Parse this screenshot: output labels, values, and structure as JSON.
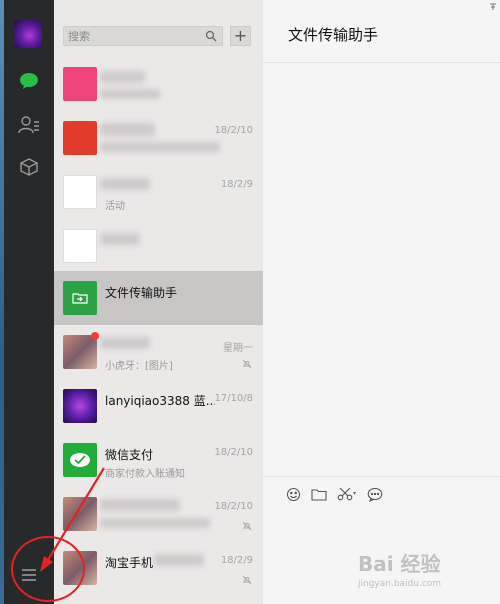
{
  "sidebar": {
    "items": [
      {
        "name": "avatar"
      },
      {
        "name": "chats-icon"
      },
      {
        "name": "contacts-icon"
      },
      {
        "name": "favorites-icon"
      },
      {
        "name": "menu-icon"
      }
    ]
  },
  "search": {
    "placeholder": "搜索"
  },
  "add_button": "+",
  "chats": [
    {
      "name": "",
      "preview": "",
      "time": "",
      "avatar_color": "#f0457a"
    },
    {
      "name": "",
      "preview": "",
      "time": "18/2/10",
      "avatar_color": "#e23b2c"
    },
    {
      "name": "",
      "preview": "活动",
      "time": "18/2/9",
      "avatar_color": "#ffffff"
    },
    {
      "name": "",
      "preview": "",
      "time": "",
      "avatar_color": "#ffffff"
    },
    {
      "name": "文件传输助手",
      "preview": "",
      "time": "",
      "avatar_color": "#2ba245"
    },
    {
      "name": "",
      "preview": "小虎牙：[图片]",
      "time": "星期一",
      "avatar_color": "#b97a6a"
    },
    {
      "name": "lanyiqiao3388 蓝...",
      "preview": "",
      "time": "17/10/8",
      "avatar_color": "#6a1fb0"
    },
    {
      "name": "微信支付",
      "preview": "商家付款入账通知",
      "time": "18/2/10",
      "avatar_color": "#22ac38"
    },
    {
      "name": "",
      "preview": "",
      "time": "18/2/10",
      "avatar_color": "#a07060"
    },
    {
      "name": "淘宝手机",
      "preview": "",
      "time": "18/2/9",
      "avatar_color": "#a07060"
    }
  ],
  "main": {
    "title": "文件传输助手"
  },
  "toolbar": {
    "emoji": "emoji-icon",
    "folder": "folder-icon",
    "screenshot": "scissors-icon",
    "caret": "▾",
    "chat_bubble": "chat-bubble-icon"
  },
  "watermark": {
    "text": "Bai 经验",
    "sub": "jingyan.baidu.com"
  },
  "colors": {
    "sidebar": "#27292b",
    "list": "#ebe9e8",
    "selected": "#c8c6c5",
    "main": "#f5f5f5",
    "annotation": "#e02424"
  }
}
